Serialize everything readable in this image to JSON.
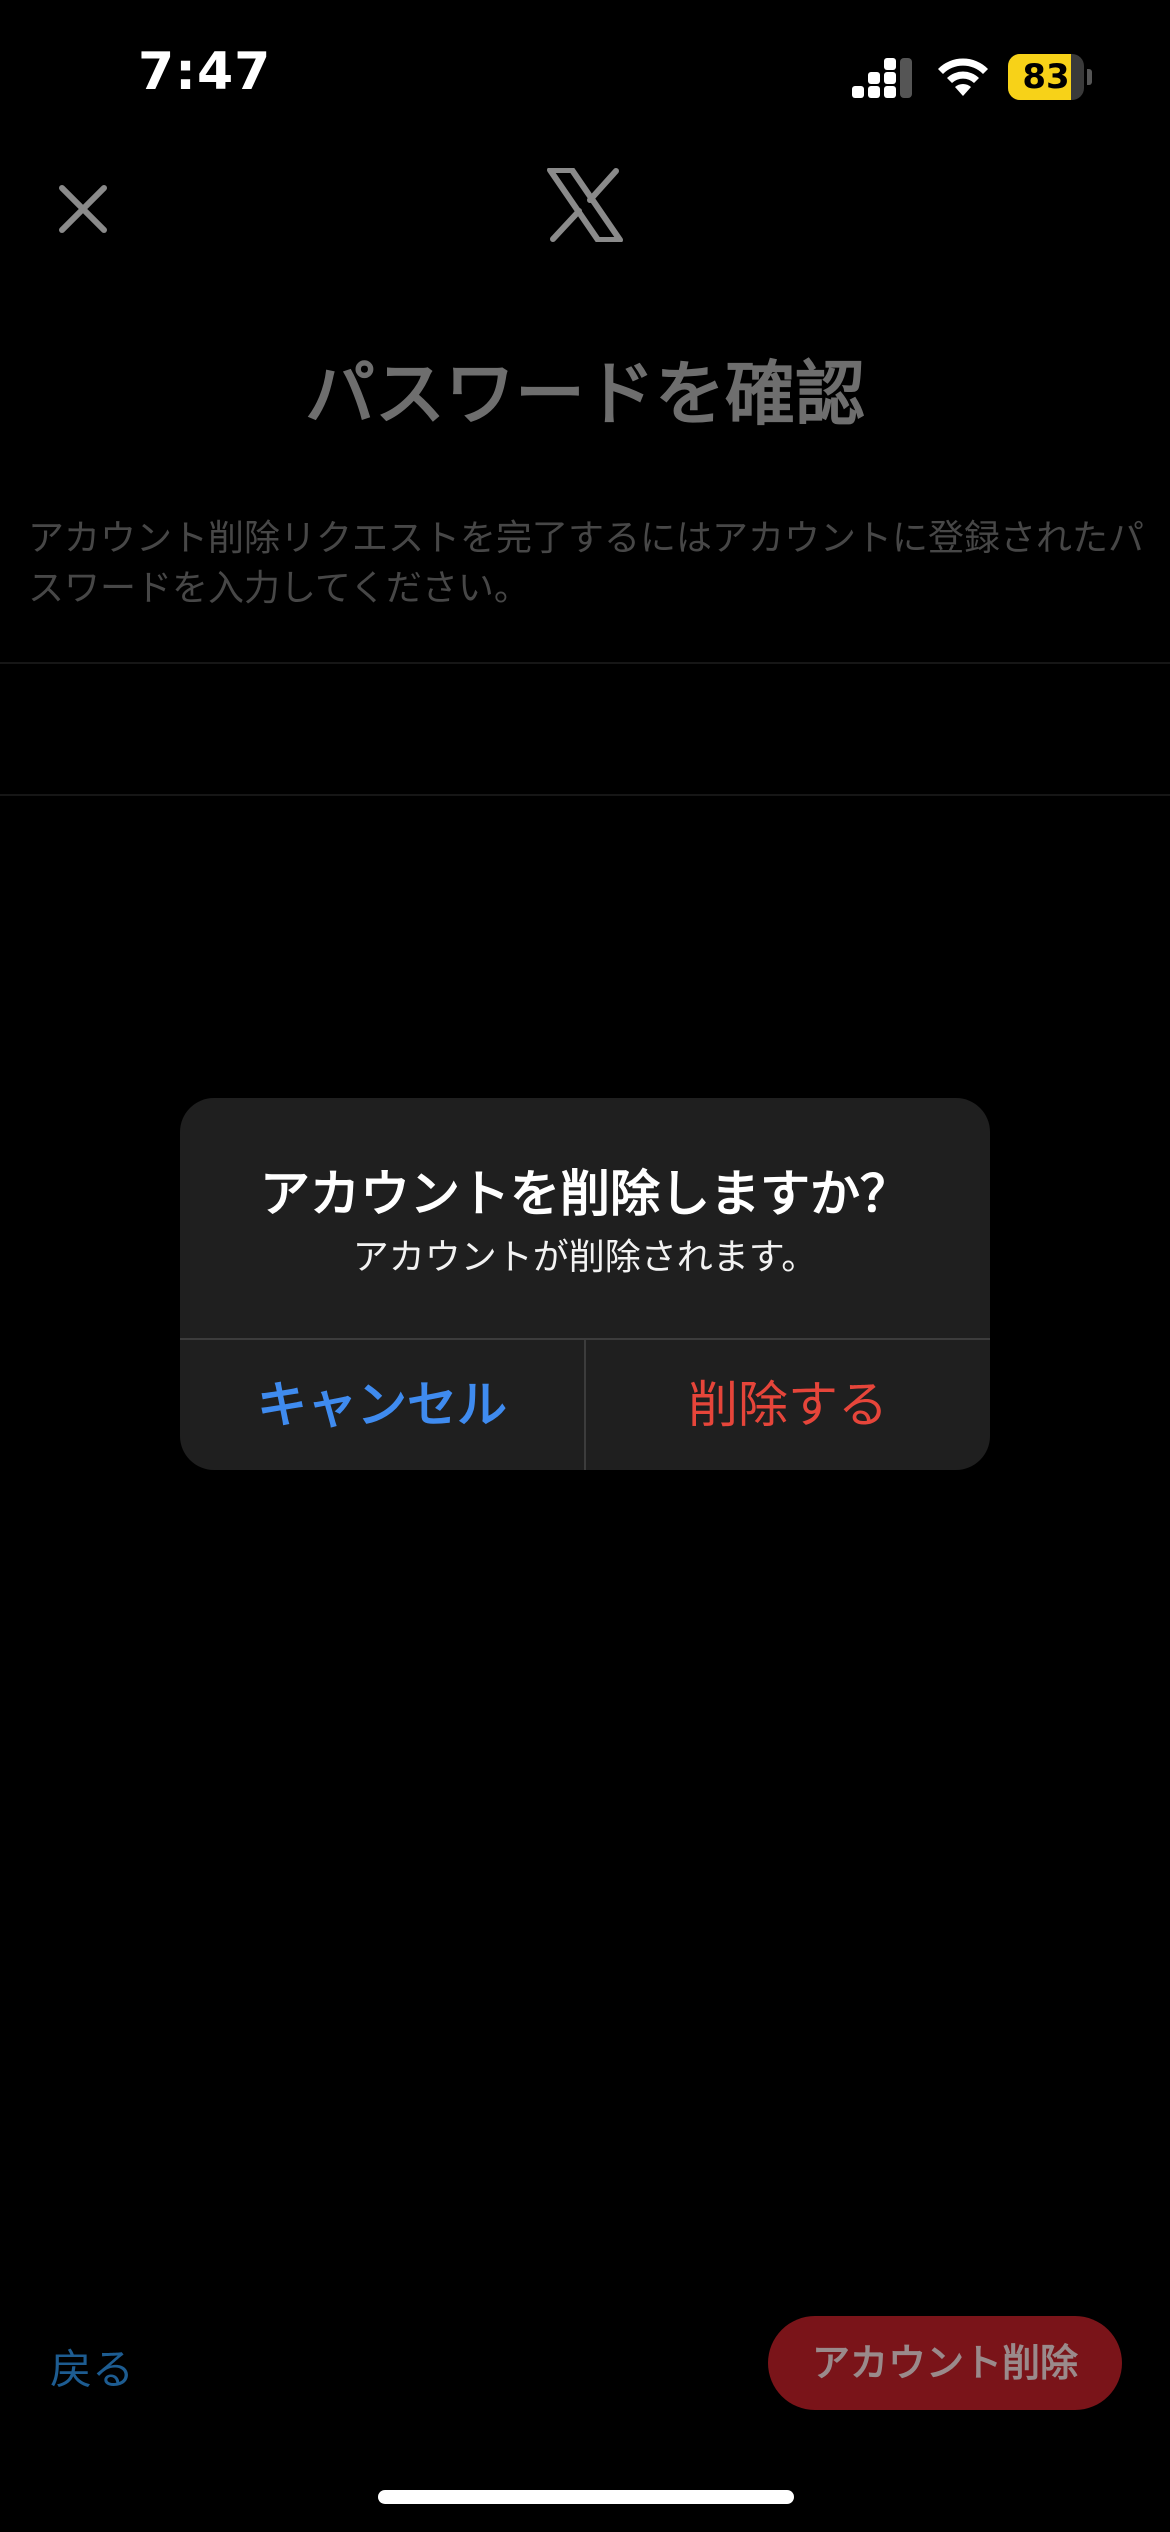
{
  "status_bar": {
    "time": "7:47",
    "battery_percent": "83",
    "battery_level": 0.83
  },
  "header": {
    "close_icon": "close-icon",
    "logo_icon": "x-logo-icon"
  },
  "page": {
    "title": "パスワードを確認",
    "description": "アカウント削除リクエストを完了するにはアカウントに登録されたパスワードを入力してください。",
    "password_value": "",
    "back_label": "戻る",
    "delete_account_label": "アカウント削除"
  },
  "alert": {
    "title": "アカウントを削除しますか？",
    "message": "アカウントが削除されます。",
    "cancel_label": "キャンセル",
    "confirm_label": "削除する"
  },
  "colors": {
    "background": "#000000",
    "alert_background": "#1f1f1f",
    "cancel_blue": "#3f8bef",
    "destructive_red": "#e6453a",
    "battery_yellow": "#f7d218",
    "delete_button_bg": "#7a1419"
  }
}
